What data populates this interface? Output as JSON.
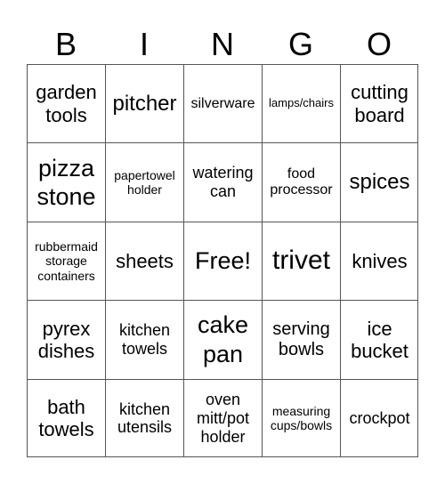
{
  "header": {
    "letters": [
      "B",
      "I",
      "N",
      "G",
      "O"
    ]
  },
  "cells": [
    [
      "garden tools",
      "pitcher",
      "silverware",
      "lamps/chairs",
      "cutting board"
    ],
    [
      "pizza stone",
      "papertowel holder",
      "watering can",
      "food processor",
      "spices"
    ],
    [
      "rubbermaid storage containers",
      "sheets",
      "Free!",
      "trivet",
      "knives"
    ],
    [
      "pyrex dishes",
      "kitchen towels",
      "cake pan",
      "serving bowls",
      "ice bucket"
    ],
    [
      "bath towels",
      "kitchen utensils",
      "oven mitt/pot holder",
      "measuring cups/bowls",
      "crockpot"
    ]
  ]
}
